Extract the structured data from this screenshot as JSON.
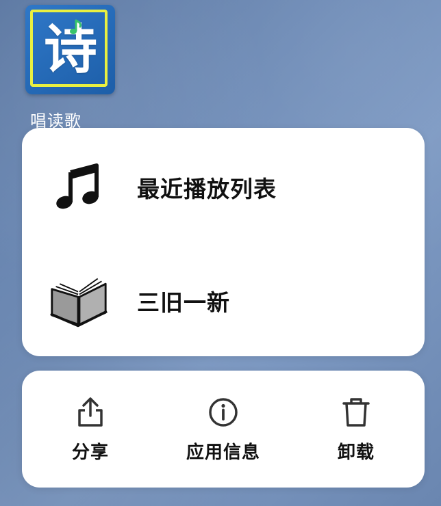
{
  "app": {
    "icon_char": "诗",
    "icon_name": "shi-poem-app-icon",
    "label": "唱读歌",
    "colors": {
      "icon_background": "#2f78c8",
      "icon_border": "#e9f040",
      "icon_note": "#39c46a"
    }
  },
  "shortcuts": [
    {
      "label": "最近播放列表",
      "icon": "music-note-icon"
    },
    {
      "label": "三旧一新",
      "icon": "open-book-icon"
    }
  ],
  "actions": [
    {
      "label": "分享",
      "icon": "share-icon"
    },
    {
      "label": "应用信息",
      "icon": "info-icon"
    },
    {
      "label": "卸载",
      "icon": "trash-icon"
    }
  ],
  "colors": {
    "card_background": "#ffffff",
    "text": "#111111",
    "wallpaper": "#6f8cb7"
  }
}
